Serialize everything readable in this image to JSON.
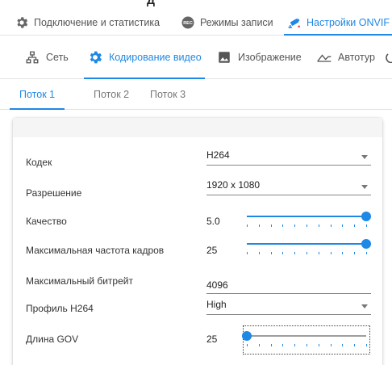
{
  "header_fragment": "Д",
  "main_tabs": [
    {
      "label": "Подключение и статистика",
      "icon": "gear-icon"
    },
    {
      "label": "Режимы записи",
      "icon": "rec-icon"
    },
    {
      "label": "Настройки ONVIF",
      "icon": "camera-icon"
    }
  ],
  "sub_tabs": [
    {
      "label": "Сеть",
      "icon": "network-icon"
    },
    {
      "label": "Кодирование видео",
      "icon": "gear-icon"
    },
    {
      "label": "Изображение",
      "icon": "image-icon"
    },
    {
      "label": "Автотур",
      "icon": "tour-icon"
    }
  ],
  "stream_tabs": [
    "Поток 1",
    "Поток 2",
    "Поток 3"
  ],
  "form": {
    "codec": {
      "label": "Кодек",
      "value": "H264"
    },
    "resolution": {
      "label": "Разрешение",
      "value": "1920 x 1080"
    },
    "quality": {
      "label": "Качество",
      "value": "5.0",
      "fraction": 1.0
    },
    "max_fps": {
      "label": "Максимальная частота кадров",
      "value": "25",
      "fraction": 1.0
    },
    "max_bitrate": {
      "label": "Максимальный битрейт",
      "value": "4096"
    },
    "h264_profile": {
      "label": "Профиль H264",
      "value": "High"
    },
    "gov_length": {
      "label": "Длина GOV",
      "value": "25",
      "fraction": 0.0
    }
  },
  "accent_color": "#1e88e5"
}
